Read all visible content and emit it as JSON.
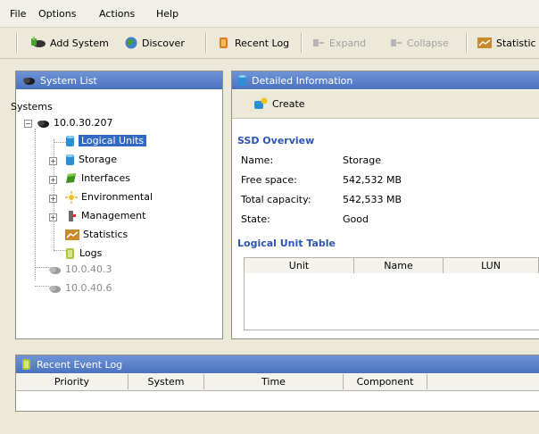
{
  "menubar": {
    "items": [
      "File",
      "Options",
      "Actions",
      "Help"
    ]
  },
  "toolbar": {
    "add_system": "Add System",
    "discover": "Discover",
    "recent_log": "Recent Log",
    "expand": "Expand",
    "collapse": "Collapse",
    "statistics": "Statistic"
  },
  "system_list": {
    "title": "System List",
    "root": "Systems",
    "host": "10.0.30.207",
    "items": [
      "Logical Units",
      "Storage",
      "Interfaces",
      "Environmental",
      "Management",
      "Statistics",
      "Logs"
    ],
    "other_hosts": [
      "10.0.40.3",
      "10.0.40.6"
    ]
  },
  "detail": {
    "title": "Detailed Information",
    "create": "Create",
    "overview_heading": "SSD Overview",
    "fields": [
      {
        "label": "Name:",
        "value": "Storage"
      },
      {
        "label": "Free space:",
        "value": "542,532 MB"
      },
      {
        "label": "Total capacity:",
        "value": "542,533 MB"
      },
      {
        "label": "State:",
        "value": "Good"
      }
    ],
    "table_heading": "Logical Unit Table",
    "columns": [
      "Unit",
      "Name",
      "LUN"
    ]
  },
  "event_log": {
    "title": "Recent Event Log",
    "columns": [
      "Priority",
      "System",
      "Time",
      "Component"
    ]
  },
  "colors": {
    "header_blue": "#4b72c0",
    "selection": "#316ac5",
    "heading_blue": "#2b55b0"
  }
}
